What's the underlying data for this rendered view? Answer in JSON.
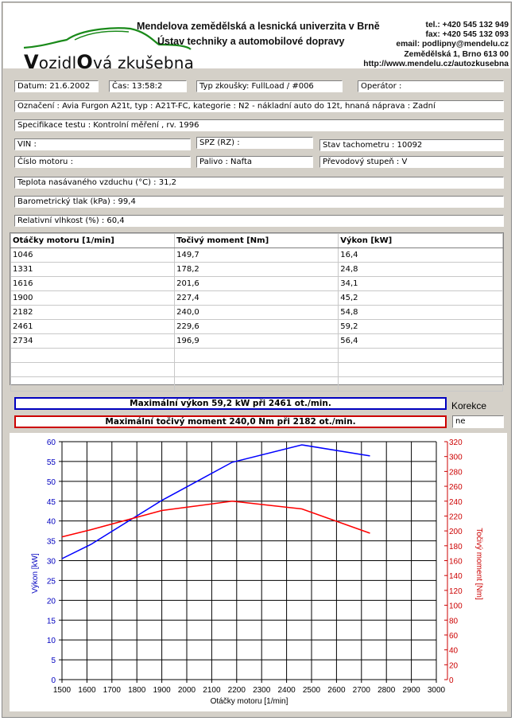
{
  "header": {
    "logo_text_1": "V",
    "logo_text_2": "ozidl",
    "logo_text_3": "O",
    "logo_text_4": "vá zkušebna",
    "university": "Mendelova zemědělská a lesnická univerzita v Brně",
    "department": "Ústav techniky a automobilové dopravy",
    "contact": [
      "tel.: +420 545 132 949",
      "fax: +420 545 132 093",
      "email: podlipny@mendelu.cz",
      "Zemědělská 1, Brno 613 00",
      "http://www.mendelu.cz/autozkusebna"
    ]
  },
  "fields": {
    "datum": "Datum: 21.6.2002",
    "cas": "Čas: 13:58:2",
    "typ": "Typ zkoušky: FullLoad / #006",
    "operator": "Operátor :",
    "oznaceni": "Označení : Avia Furgon A21t, typ : A21T-FC, kategorie : N2 - nákladní auto do 12t, hnaná náprava : Zadní",
    "specifikace": "Specifikace testu : Kontrolní měření , rv. 1996",
    "vin": "VIN :",
    "spz": "SPZ (RZ) :",
    "tachometr": "Stav tachometru : 10092",
    "cislo_motoru": "Číslo motoru :",
    "palivo": "Palivo : Nafta",
    "prevod": "Převodový stupeň : V",
    "teplota": "Teplota nasávaného vzduchu (°C) : 31,2",
    "tlak": "Barometrický tlak (kPa) : 99,4",
    "vlhkost": "Relativní vlhkost (%) : 60,4"
  },
  "table": {
    "headers": [
      "Otáčky motoru [1/min]",
      "Točivý moment [Nm]",
      "Výkon [kW]"
    ],
    "rows": [
      [
        "1046",
        "149,7",
        "16,4"
      ],
      [
        "1331",
        "178,2",
        "24,8"
      ],
      [
        "1616",
        "201,6",
        "34,1"
      ],
      [
        "1900",
        "227,4",
        "45,2"
      ],
      [
        "2182",
        "240,0",
        "54,8"
      ],
      [
        "2461",
        "229,6",
        "59,2"
      ],
      [
        "2734",
        "196,9",
        "56,4"
      ],
      [
        "",
        "",
        ""
      ],
      [
        "",
        "",
        ""
      ],
      [
        "",
        "",
        ""
      ]
    ]
  },
  "max_power": "Maximální výkon 59,2 kW při 2461 ot./min.",
  "max_torque": "Maximální točivý moment 240,0 Nm při 2182 ot./min.",
  "korekce_label": "Korekce",
  "korekce_value": "ne",
  "colors": {
    "power": "#0000ff",
    "torque": "#ff0000",
    "power_box": "#0000c0",
    "torque_box": "#cc0000"
  },
  "chart_data": {
    "type": "line",
    "xlabel": "Otáčky motoru [1/min]",
    "ylabel_left": "Výkon [kW]",
    "ylabel_right": "Točivý moment [Nm]",
    "xlim": [
      1500,
      3000
    ],
    "ylim_left": [
      0,
      60
    ],
    "ylim_right": [
      0,
      320
    ],
    "x_ticks": [
      1500,
      1600,
      1700,
      1800,
      1900,
      2000,
      2100,
      2200,
      2300,
      2400,
      2500,
      2600,
      2700,
      2800,
      2900,
      3000
    ],
    "y_ticks_left": [
      0,
      5,
      10,
      15,
      20,
      25,
      30,
      35,
      40,
      45,
      50,
      55,
      60
    ],
    "y_ticks_right": [
      0,
      20,
      40,
      60,
      80,
      100,
      120,
      140,
      160,
      180,
      200,
      220,
      240,
      260,
      280,
      300,
      320
    ],
    "grid": true,
    "series": [
      {
        "name": "Výkon [kW]",
        "axis": "left",
        "color": "#0000ff",
        "x": [
          1500,
          1616,
          1900,
          2182,
          2461,
          2734
        ],
        "y": [
          30.5,
          34.1,
          45.2,
          54.8,
          59.2,
          56.4
        ]
      },
      {
        "name": "Točivý moment [Nm]",
        "axis": "right",
        "color": "#ff0000",
        "x": [
          1500,
          1616,
          1900,
          2182,
          2461,
          2734
        ],
        "y": [
          192,
          201.6,
          227.4,
          240.0,
          229.6,
          196.9
        ]
      }
    ]
  }
}
